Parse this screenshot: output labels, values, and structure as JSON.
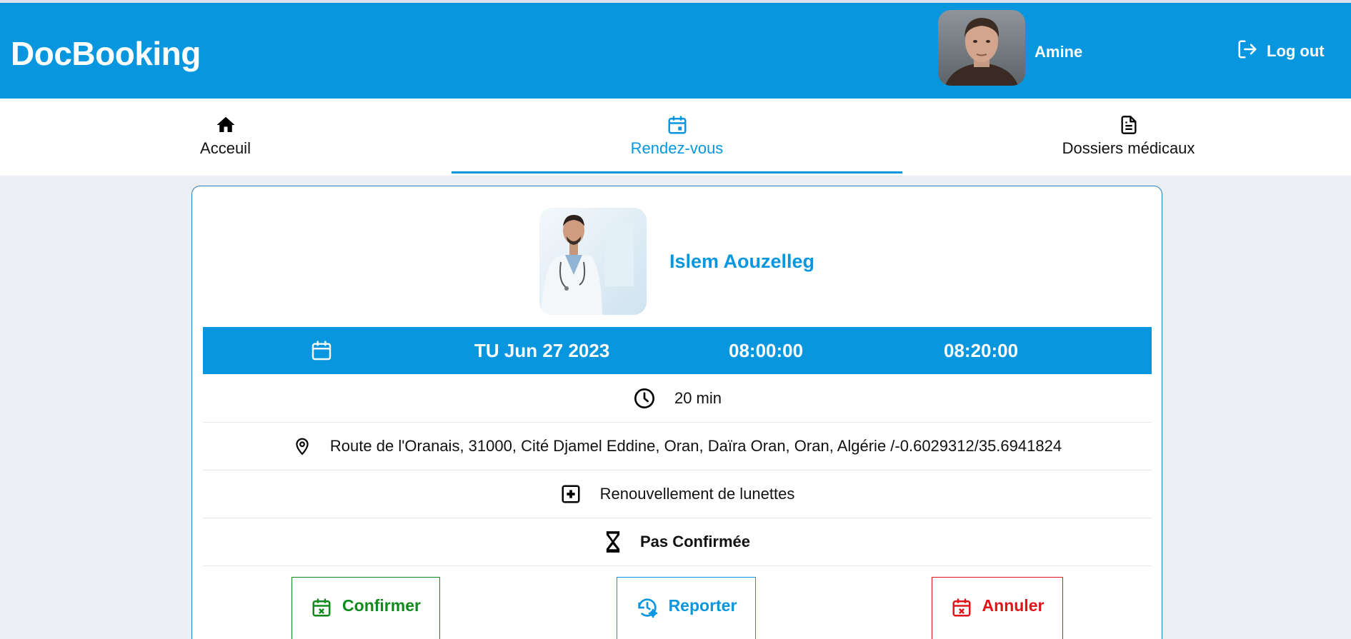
{
  "app": {
    "title": "DocBooking"
  },
  "header": {
    "user_name": "Amine",
    "logout_label": "Log out"
  },
  "tabs": [
    {
      "label": "Acceuil",
      "icon": "home-icon",
      "active": false
    },
    {
      "label": "Rendez-vous",
      "icon": "calendar-icon",
      "active": true
    },
    {
      "label": "Dossiers médicaux",
      "icon": "file-icon",
      "active": false
    }
  ],
  "appointment": {
    "doctor_name": "Islem Aouzelleg",
    "date": "TU Jun 27 2023",
    "start_time": "08:00:00",
    "end_time": "08:20:00",
    "duration": "20 min",
    "address": "Route de l'Oranais, 31000, Cité Djamel Eddine, Oran, Daïra Oran, Oran, Algérie /-0.6029312/35.6941824",
    "reason": "Renouvellement de lunettes",
    "status": "Pas Confirmée"
  },
  "actions": {
    "confirm_label": "Confirmer",
    "report_label": "Reporter",
    "cancel_label": "Annuler"
  },
  "colors": {
    "primary": "#0896df",
    "confirm": "#0f8a1d",
    "cancel": "#e0141a",
    "background": "#ebeef2"
  }
}
